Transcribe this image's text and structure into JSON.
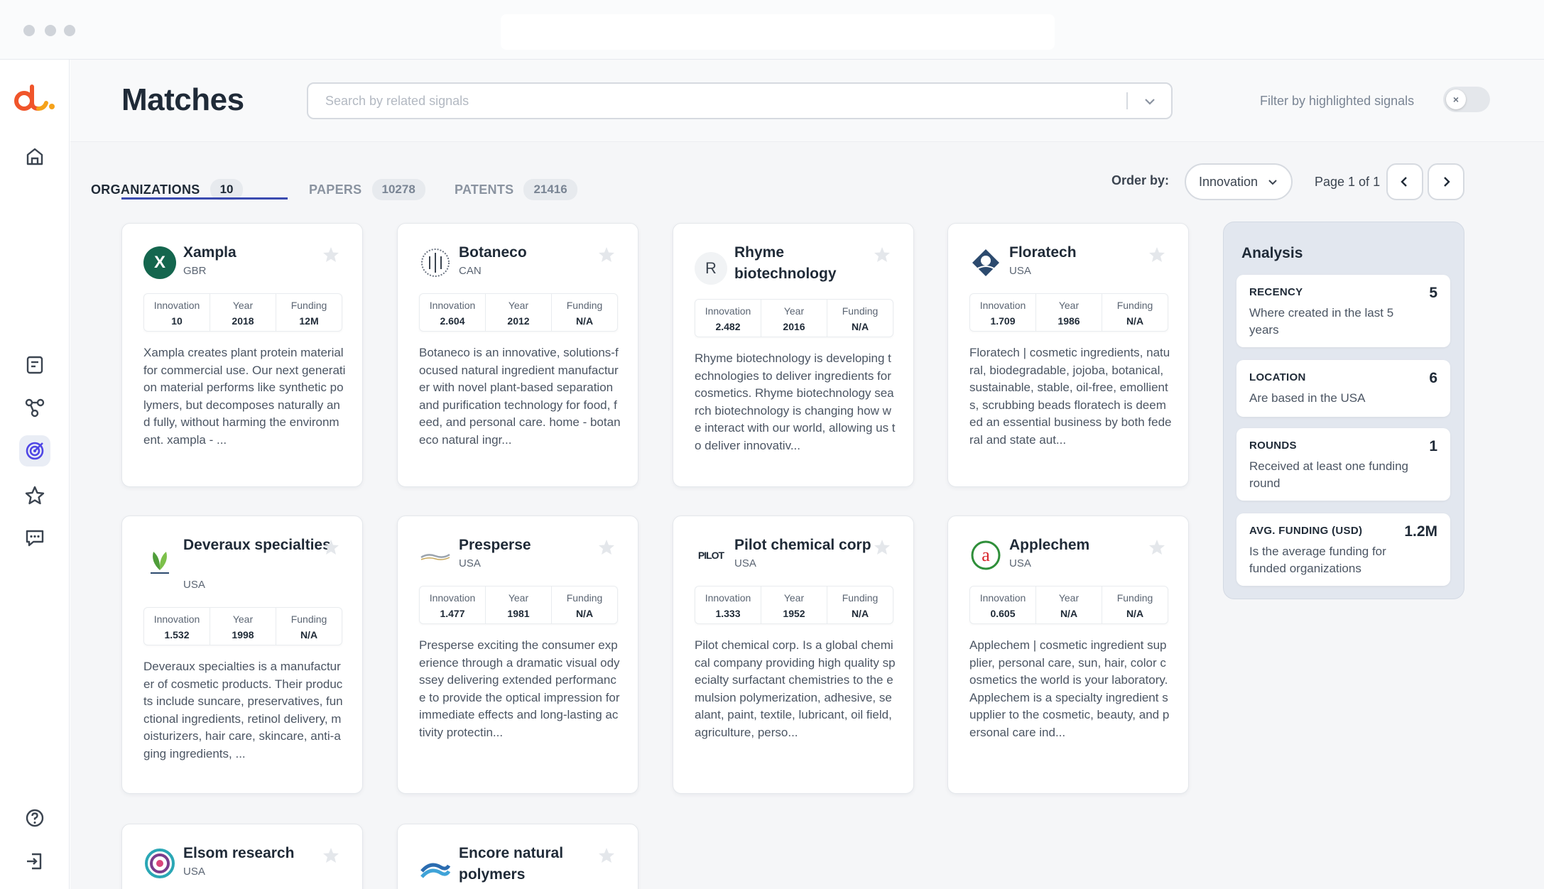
{
  "window": {
    "controls": [
      "close",
      "minimize",
      "maximize"
    ]
  },
  "sidebar": {
    "logo": "dots-logo",
    "items": [
      {
        "icon": "home-icon"
      },
      {
        "icon": "document-icon"
      },
      {
        "icon": "graph-icon"
      },
      {
        "icon": "target-icon",
        "active": true
      },
      {
        "icon": "star-icon"
      },
      {
        "icon": "chat-icon"
      },
      {
        "icon": "help-icon"
      },
      {
        "icon": "logout-icon"
      }
    ]
  },
  "header": {
    "title": "Matches",
    "search_placeholder": "Search by related signals",
    "filter_label": "Filter by highlighted signals",
    "toggle_knob": "×"
  },
  "tabs": [
    {
      "label": "ORGANIZATIONS",
      "count": "10",
      "active": true
    },
    {
      "label": "PAPERS",
      "count": "10278"
    },
    {
      "label": "PATENTS",
      "count": "21416"
    }
  ],
  "order": {
    "label": "Order by:",
    "value": "Innovation",
    "page": "Page 1 of 1"
  },
  "metric_labels": {
    "innovation": "Innovation",
    "year": "Year",
    "funding": "Funding"
  },
  "cards": [
    {
      "name": "Xampla",
      "country": "GBR",
      "innovation": "10",
      "year": "2018",
      "funding": "12M",
      "desc": "Xampla creates plant protein material for commercial use. Our next generation material performs like synthetic polymers, but decomposes naturally and fully, without harming the environment. xampla - ..."
    },
    {
      "name": "Botaneco",
      "country": "CAN",
      "innovation": "2.604",
      "year": "2012",
      "funding": "N/A",
      "desc": "Botaneco is an innovative, solutions-focused natural ingredient manufacturer with novel plant-based separation and purification technology for food, feed, and personal care. home - botaneco natural ingr..."
    },
    {
      "name": "Rhyme biotechnology",
      "country": "",
      "initial": "R",
      "innovation": "2.482",
      "year": "2016",
      "funding": "N/A",
      "desc": "Rhyme biotechnology is developing technologies to deliver ingredients for cosmetics. Rhyme biotechnology search biotechnology is changing how we interact with our world, allowing us to deliver innovativ..."
    },
    {
      "name": "Floratech",
      "country": "USA",
      "innovation": "1.709",
      "year": "1986",
      "funding": "N/A",
      "desc": "Floratech | cosmetic ingredients, natural, biodegradable, jojoba, botanical, sustainable, stable, oil-free, emollients, scrubbing beads floratech is deemed an essential business by both federal and state aut..."
    },
    {
      "name": "Deveraux specialties",
      "country": "USA",
      "innovation": "1.532",
      "year": "1998",
      "funding": "N/A",
      "desc": "Deveraux specialties is a manufacturer of cosmetic products. Their products include suncare, preservatives, functional ingredients, retinol delivery, moisturizers, hair care, skincare, anti-aging ingredients, ..."
    },
    {
      "name": "Presperse",
      "country": "USA",
      "innovation": "1.477",
      "year": "1981",
      "funding": "N/A",
      "desc": "Presperse exciting the consumer experience through a dramatic visual odyssey delivering extended performance to provide the optical impression for immediate effects and long-lasting activity protectin..."
    },
    {
      "name": "Pilot chemical corp",
      "country": "USA",
      "logo_text": "PILOT",
      "innovation": "1.333",
      "year": "1952",
      "funding": "N/A",
      "desc": "Pilot chemical corp. Is a global chemical company providing high quality specialty surfactant chemistries to the emulsion polymerization, adhesive, sealant, paint, textile, lubricant, oil field, agriculture, perso..."
    },
    {
      "name": "Applechem",
      "country": "USA",
      "innovation": "0.605",
      "year": "N/A",
      "funding": "N/A",
      "desc": "Applechem | cosmetic ingredient supplier, personal care, sun, hair, color cosmetics the world is your laboratory. Applechem is a specialty ingredient supplier to the cosmetic, beauty, and personal care ind..."
    },
    {
      "name": "Elsom research",
      "country": "USA"
    },
    {
      "name": "Encore natural polymers",
      "country": ""
    }
  ],
  "analysis": {
    "title": "Analysis",
    "items": [
      {
        "key": "RECENCY",
        "value": "5",
        "desc": "Where created in the last 5 years"
      },
      {
        "key": "LOCATION",
        "value": "6",
        "desc": "Are based in the USA"
      },
      {
        "key": "ROUNDS",
        "value": "1",
        "desc": "Received at least one funding round"
      },
      {
        "key": "AVG. FUNDING (USD)",
        "value": "1.2M",
        "desc": "Is the average funding for funded organizations"
      }
    ]
  }
}
